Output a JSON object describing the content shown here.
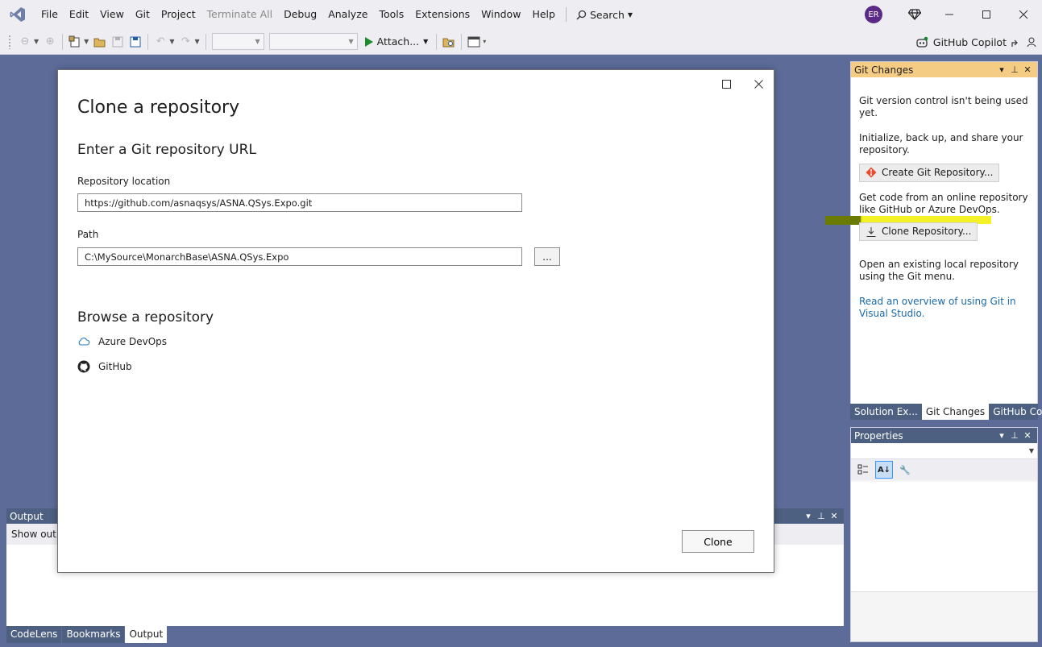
{
  "menu": {
    "items": [
      "File",
      "Edit",
      "View",
      "Git",
      "Project"
    ],
    "terminate_all": "Terminate All",
    "items2": [
      "Debug",
      "Analyze",
      "Tools",
      "Extensions",
      "Window",
      "Help"
    ],
    "search_label": "Search"
  },
  "titlebar": {
    "avatar_initials": "ER"
  },
  "toolbar": {
    "attach_label": "Attach...",
    "copilot_label": "GitHub Copilot"
  },
  "git_panel": {
    "title": "Git Changes",
    "line1": "Git version control isn't being used yet.",
    "line2": "Initialize, back up, and share your repository.",
    "create_button": "Create Git Repository...",
    "line3": "Get code from an online repository like GitHub or Azure DevOps.",
    "clone_button": "Clone Repository...",
    "line4": "Open an existing local repository using the Git menu.",
    "link": "Read an overview of using Git in Visual Studio."
  },
  "right_tabs": [
    "Solution Ex...",
    "Git Changes",
    "GitHub Co..."
  ],
  "properties": {
    "title": "Properties"
  },
  "output": {
    "title": "Output",
    "show_output_label": "Show outp"
  },
  "bottom_tabs": [
    "CodeLens",
    "Bookmarks",
    "Output"
  ],
  "dialog": {
    "title": "Clone a repository",
    "subtitle": "Enter a Git repository URL",
    "repo_label": "Repository location",
    "repo_value": "https://github.com/asnaqsys/ASNA.QSys.Expo.git",
    "path_label": "Path",
    "path_value": "C:\\MySource\\MonarchBase\\ASNA.QSys.Expo",
    "browse_label": "...",
    "browse_title": "Browse a repository",
    "providers": [
      "Azure DevOps",
      "GitHub"
    ],
    "clone_button": "Clone"
  },
  "colors": {
    "accent_tab": "#f5cc84",
    "chrome": "#eeeef2",
    "background": "#5d6b99",
    "highlight": "#f2f000"
  }
}
